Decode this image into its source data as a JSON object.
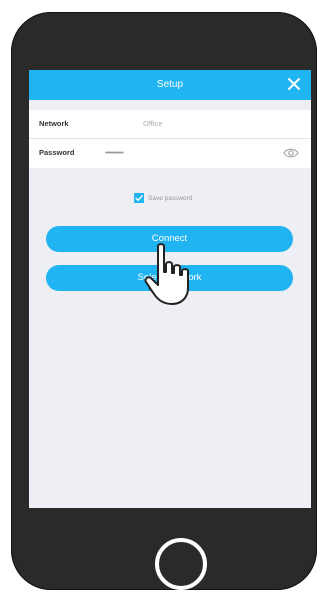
{
  "header": {
    "title": "Setup",
    "close_icon": "close-icon"
  },
  "form": {
    "network_label": "Network",
    "network_value": "Office",
    "password_label": "Password",
    "password_value": "•••••••••••",
    "show_password_icon": "eye-icon"
  },
  "save_password": {
    "label": "Save password",
    "checked": true
  },
  "buttons": {
    "connect": "Connect",
    "select_network": "Select Network"
  },
  "colors": {
    "accent": "#21b4f2",
    "phone_body": "#2a2a2a",
    "screen_background": "#eeeff4"
  },
  "overlay": {
    "pointer_icon": "hand-pointer-icon"
  }
}
